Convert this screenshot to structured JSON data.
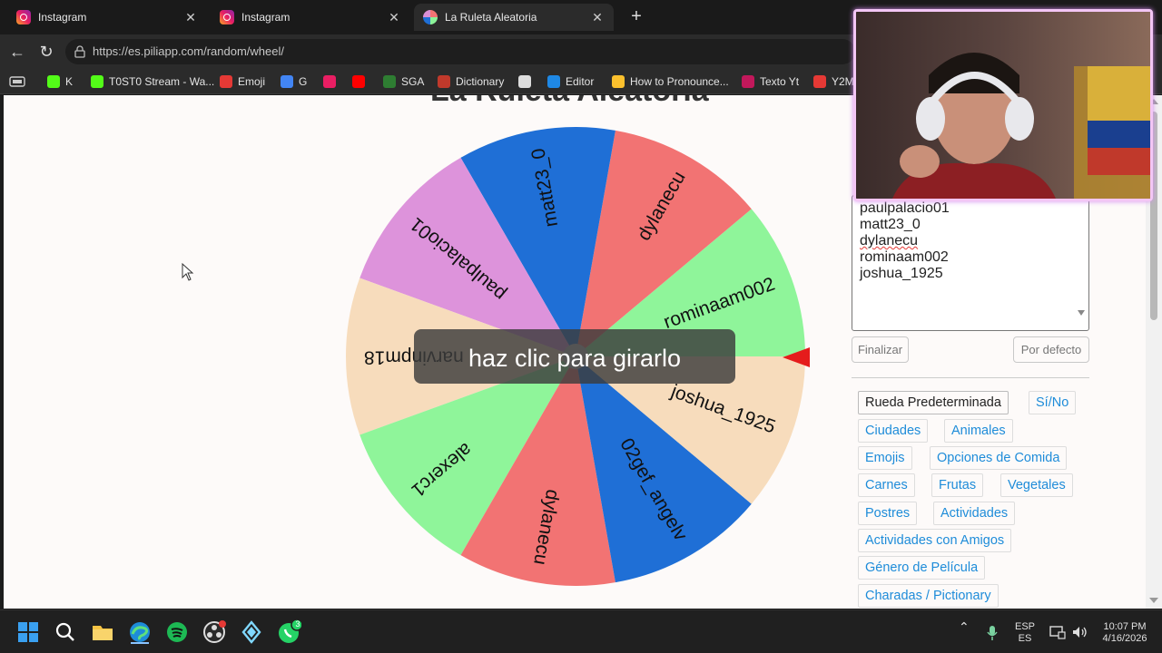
{
  "browser": {
    "tabs": [
      {
        "label": "Instagram",
        "favicon": "instagram-icon",
        "active": false
      },
      {
        "label": "Instagram",
        "favicon": "instagram-icon",
        "active": false
      },
      {
        "label": "La Ruleta Aleatoria",
        "favicon": "wheel-icon",
        "active": true
      }
    ],
    "url": "https://es.piliapp.com/random/wheel/",
    "bookmarks": [
      {
        "label": "K",
        "icon": "kick-icon",
        "color": "#53fc18"
      },
      {
        "label": "T0ST0 Stream - Wa...",
        "icon": "kick-icon",
        "color": "#53fc18"
      },
      {
        "label": "Emoji",
        "icon": "bolt-icon",
        "color": "#e53935"
      },
      {
        "label": "G",
        "icon": "google-icon",
        "color": "#4285f4"
      },
      {
        "label": "",
        "icon": "instagram-icon",
        "color": "#e91e63"
      },
      {
        "label": "",
        "icon": "youtube-icon",
        "color": "#ff0000"
      },
      {
        "label": "SGA",
        "icon": "sga-icon",
        "color": "#2e7d32"
      },
      {
        "label": "Dictionary",
        "icon": "dictionary-icon",
        "color": "#c0392b"
      },
      {
        "label": "",
        "icon": "openai-icon",
        "color": "#dddddd"
      },
      {
        "label": "Editor",
        "icon": "editor-icon",
        "color": "#1e88e5"
      },
      {
        "label": "How to Pronounce...",
        "icon": "pronounce-icon",
        "color": "#fbc02d"
      },
      {
        "label": "Texto Yt",
        "icon": "youtube-icon",
        "color": "#c2185b"
      },
      {
        "label": "Y2M",
        "icon": "y2m-icon",
        "color": "#e53935"
      }
    ]
  },
  "page": {
    "title": "La Ruleta Aleatoria",
    "overlay_text": "haz clic para girarlo",
    "wheel_segments": [
      {
        "name": "rominaam002",
        "color": "#8ff59a"
      },
      {
        "name": "dylanecu",
        "color": "#f27373"
      },
      {
        "name": "matt23_0",
        "color": "#1f6fd6"
      },
      {
        "name": "paulpalacio01",
        "color": "#dd93db"
      },
      {
        "name": "narvinpm18",
        "color": "#f7dcbc"
      },
      {
        "name": "alexerc1",
        "color": "#8ff59a"
      },
      {
        "name": "dylanecu",
        "color": "#f27373"
      },
      {
        "name": "02gef_angelv",
        "color": "#1f6fd6"
      },
      {
        "name": "joshua_1925",
        "color": "#f7dcbc"
      }
    ],
    "names_list": [
      "paulpalacio01",
      "matt23_0",
      "dylanecu",
      "rominaam002",
      "joshua_1925"
    ],
    "finalize_label": "Finalizar",
    "default_label": "Por defecto",
    "presets": [
      [
        "Rueda Predeterminada",
        "Sí/No"
      ],
      [
        "Ciudades",
        "Animales"
      ],
      [
        "Emojis",
        "Opciones de Comida"
      ],
      [
        "Carnes",
        "Frutas",
        "Vegetales"
      ],
      [
        "Postres",
        "Actividades"
      ],
      [
        "Actividades con Amigos"
      ],
      [
        "Género de Película"
      ],
      [
        "Charadas / Pictionary"
      ]
    ]
  },
  "taskbar": {
    "whatsapp_badge": "3",
    "lang_top": "ESP",
    "lang_bottom": "ES",
    "time": "10:07 PM",
    "date": "4/16/2026"
  }
}
